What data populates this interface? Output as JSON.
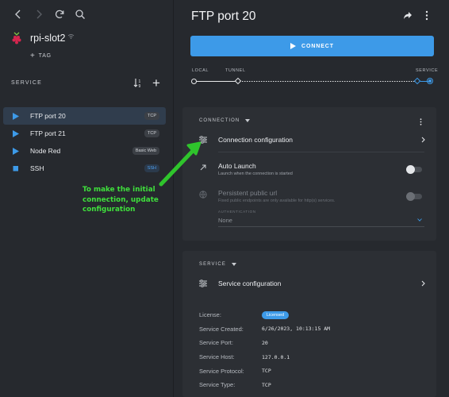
{
  "sidebar": {
    "device": {
      "name": "rpi-slot2",
      "tag_label": "TAG"
    },
    "service_header": "SERVICE",
    "services": [
      {
        "name": "FTP port 20",
        "badge": "TCP",
        "icon": "play-icon",
        "active": true
      },
      {
        "name": "FTP port 21",
        "badge": "TCP",
        "icon": "play-icon",
        "active": false
      },
      {
        "name": "Node Red",
        "badge": "Basic Web",
        "icon": "play-icon",
        "active": false
      },
      {
        "name": "SSH",
        "badge": "SSH",
        "icon": "stop-icon",
        "active": false
      }
    ]
  },
  "main": {
    "title": "FTP port 20",
    "connect_label": "CONNECT",
    "route": {
      "local": "LOCAL",
      "tunnel": "TUNNEL",
      "service": "SERVICE"
    },
    "connection_card": {
      "header": "CONNECTION",
      "config_label": "Connection configuration",
      "auto_launch": {
        "title": "Auto Launch",
        "desc": "Launch when the connection is started"
      },
      "public_url": {
        "title": "Persistent public url",
        "desc": "Fixed public endpoints are only available for http(s) services."
      },
      "auth": {
        "label": "AUTHENTICATION",
        "value": "None"
      }
    },
    "service_card": {
      "header": "SERVICE",
      "config_label": "Service configuration",
      "license_label": "License:",
      "license_value": "Licensed",
      "rows": [
        {
          "key": "Service Created:",
          "value": "6/26/2023, 10:13:15 AM"
        },
        {
          "key": "Service Port:",
          "value": "20"
        },
        {
          "key": "Service Host:",
          "value": "127.0.0.1"
        },
        {
          "key": "Service Protocol:",
          "value": "TCP"
        },
        {
          "key": "Service Type:",
          "value": "TCP"
        }
      ]
    }
  },
  "annotation": {
    "text": "To make the initial connection, update configuration"
  },
  "colors": {
    "accent": "#3d9ae8",
    "annotation": "#3fe03c",
    "background": "#26292e",
    "card": "#2c2f34"
  }
}
